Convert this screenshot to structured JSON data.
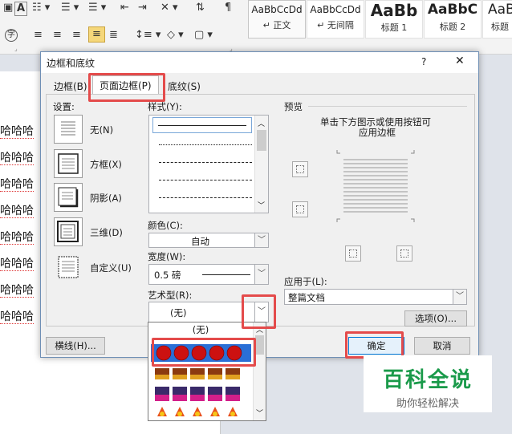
{
  "ribbon": {
    "styles": [
      {
        "sample": "AaBbCcDd",
        "name": "↵ 正文"
      },
      {
        "sample": "AaBbCcDd",
        "name": "↵ 无间隔"
      },
      {
        "sample": "AaBb",
        "name": "标题 1"
      },
      {
        "sample": "AaBbC",
        "name": "标题 2"
      },
      {
        "sample": "AaBb",
        "name": "标题"
      }
    ]
  },
  "document": {
    "lines": [
      "哈哈哈",
      "哈哈哈",
      "哈哈哈",
      "哈哈哈",
      "哈哈哈",
      "哈哈哈",
      "哈哈哈",
      "哈哈哈"
    ]
  },
  "dialog": {
    "title": "边框和底纹",
    "help": "?",
    "close": "✕",
    "tabs": [
      "边框(B)",
      "页面边框(P)",
      "底纹(S)"
    ],
    "active_tab": 1,
    "settings": {
      "label": "设置:",
      "items": [
        "无(N)",
        "方框(X)",
        "阴影(A)",
        "三维(D)",
        "自定义(U)"
      ]
    },
    "style": {
      "label": "样式(Y):"
    },
    "color": {
      "label": "颜色(C):",
      "value": "自动"
    },
    "width": {
      "label": "宽度(W):",
      "value": "0.5 磅"
    },
    "art": {
      "label": "艺术型(R):",
      "value": "(无)"
    },
    "preview": {
      "label": "预览",
      "hint_line1": "单击下方图示或使用按钮可",
      "hint_line2": "应用边框"
    },
    "apply": {
      "label": "应用于(L):",
      "value": "整篇文档"
    },
    "buttons": {
      "options": "选项(O)...",
      "horizontal_line": "横线(H)...",
      "ok": "确定",
      "cancel": "取消"
    }
  },
  "dropdown": {
    "none_label": "(无)"
  },
  "watermark": {
    "title": "百科全说",
    "subtitle": "助你轻松解决"
  },
  "colors": {
    "highlight_red": "#e44b4b",
    "accent_green": "#1a9a4a"
  }
}
